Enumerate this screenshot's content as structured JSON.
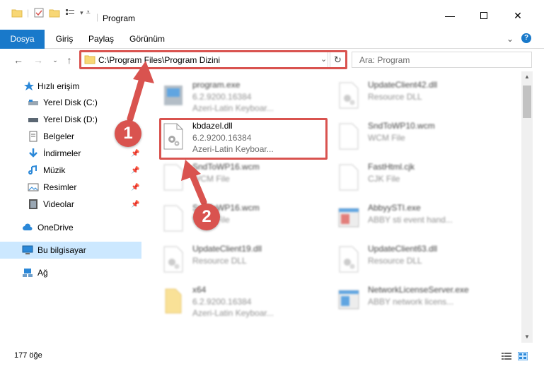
{
  "window": {
    "title": "Program",
    "minimize_icon": "minimize-icon",
    "maximize_icon": "maximize-icon",
    "close_icon": "close-icon"
  },
  "ribbon": {
    "tabs": [
      {
        "label": "Dosya",
        "active": true
      },
      {
        "label": "Giriş",
        "active": false
      },
      {
        "label": "Paylaş",
        "active": false
      },
      {
        "label": "Görünüm",
        "active": false
      }
    ],
    "accent_color": "#1979ca"
  },
  "address": {
    "path": "C:\\Program Files\\Program Dizini"
  },
  "search": {
    "placeholder": "Ara: Program"
  },
  "sidebar": {
    "items": [
      {
        "label": "Hızlı erişim",
        "icon": "star-icon"
      },
      {
        "label": "Yerel Disk (C:)",
        "icon": "drive-icon"
      },
      {
        "label": "Yerel Disk (D:)",
        "icon": "drive-icon"
      },
      {
        "label": "Belgeler",
        "icon": "documents-icon"
      },
      {
        "label": "İndirmeler",
        "icon": "download-icon"
      },
      {
        "label": "Müzik",
        "icon": "music-icon"
      },
      {
        "label": "Resimler",
        "icon": "pictures-icon"
      },
      {
        "label": "Videolar",
        "icon": "video-icon"
      },
      {
        "label": "OneDrive",
        "icon": "cloud-icon"
      },
      {
        "label": "Bu bilgisayar",
        "icon": "computer-icon"
      },
      {
        "label": "Ağ",
        "icon": "network-icon"
      }
    ]
  },
  "files": [
    {
      "name": "program.exe",
      "line2": "6.2.9200.16384",
      "line3": "Azeri-Latin Keyboar..."
    },
    {
      "name": "UpdateClient42.dll",
      "line2": "Resource DLL",
      "line3": ""
    },
    {
      "name": "kbdazel.dll",
      "line2": "6.2.9200.16384",
      "line3": "Azeri-Latin Keyboar..."
    },
    {
      "name": "SndToWP10.wcm",
      "line2": "WCM File",
      "line3": ""
    },
    {
      "name": "SndToWP16.wcm",
      "line2": "WCM File",
      "line3": ""
    },
    {
      "name": "FastHtml.cjk",
      "line2": "CJK File",
      "line3": ""
    },
    {
      "name": "SndToWP16.wcm",
      "line2": "WCM File",
      "line3": ""
    },
    {
      "name": "AbbyySTI.exe",
      "line2": "ABBY sti event hand...",
      "line3": ""
    },
    {
      "name": "UpdateClient19.dll",
      "line2": "Resource DLL",
      "line3": ""
    },
    {
      "name": "UpdateClient63.dll",
      "line2": "Resource DLL",
      "line3": ""
    },
    {
      "name": "x64",
      "line2": "6.2.9200.16384",
      "line3": "Azeri-Latin Keyboar..."
    },
    {
      "name": "NetworkLicenseServer.exe",
      "line2": "ABBY network licens...",
      "line3": ""
    }
  ],
  "status": {
    "count": "177 öğe"
  },
  "annotations": {
    "step1": "1",
    "step2": "2",
    "color": "#d9534f"
  }
}
